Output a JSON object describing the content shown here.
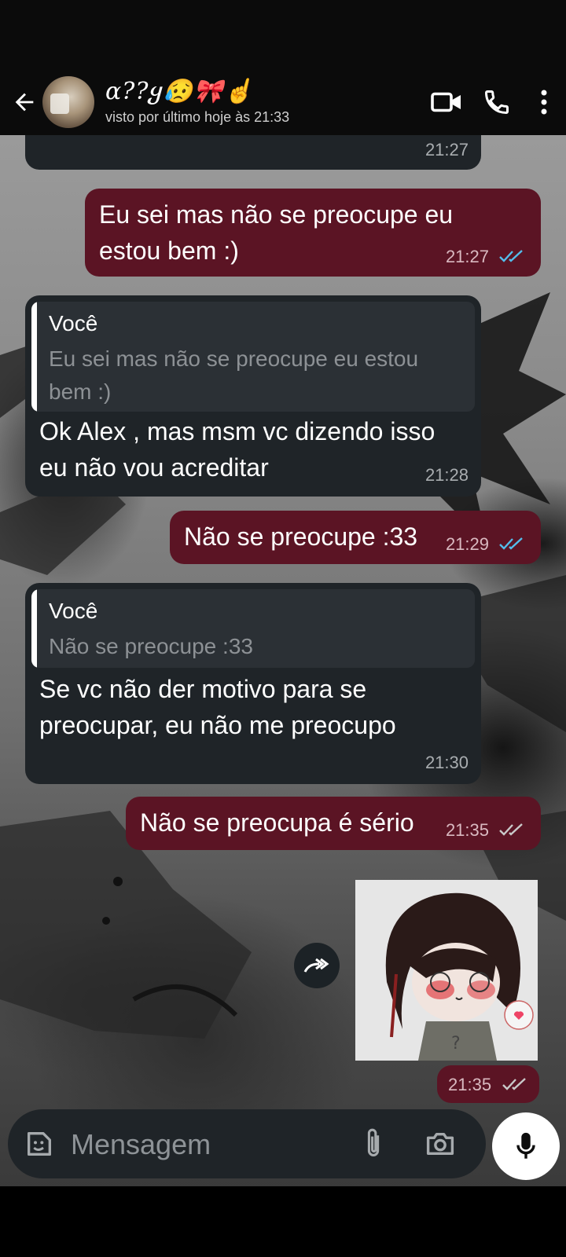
{
  "header": {
    "contact_name": "ɑ??ყ😥🎀☝",
    "last_seen": "visto por último hoje às 21:33"
  },
  "messages": [
    {
      "id": "m0",
      "direction": "in",
      "text": "",
      "time": "21:27"
    },
    {
      "id": "m1",
      "direction": "out",
      "lines": [
        "Eu sei mas não se preocupe eu",
        "estou bem :)"
      ],
      "time": "21:27",
      "status": "read"
    },
    {
      "id": "m2",
      "direction": "in",
      "quote_author": "Você",
      "quote_lines": [
        "Eu sei mas não se preocupe eu estou",
        "bem :)"
      ],
      "lines": [
        "Ok Alex , mas msm vc dizendo isso",
        "eu não vou acreditar"
      ],
      "time": "21:28"
    },
    {
      "id": "m3",
      "direction": "out",
      "lines": [
        "Não se preocupe :33"
      ],
      "time": "21:29",
      "status": "read"
    },
    {
      "id": "m4",
      "direction": "in",
      "quote_author": "Você",
      "quote_lines": [
        "Não se preocupe :33"
      ],
      "lines": [
        "Se vc não der motivo para se",
        "preocupar, eu não me preocupo"
      ],
      "time": "21:30"
    },
    {
      "id": "m5",
      "direction": "out",
      "lines": [
        "Não se preocupa é sério"
      ],
      "time": "21:35",
      "status": "delivered"
    },
    {
      "id": "m6",
      "direction": "out",
      "type": "sticker",
      "time": "21:35",
      "status": "delivered"
    }
  ],
  "input": {
    "placeholder": "Mensagem"
  },
  "colors": {
    "incoming": "#1f2428",
    "outgoing": "#5b1424",
    "read_tick": "#53bdeb",
    "delivered_tick": "#c9c9c9"
  },
  "icons": [
    "back-arrow-icon",
    "video-call-icon",
    "phone-icon",
    "more-vert-icon",
    "sticker-icon",
    "attach-icon",
    "camera-icon",
    "mic-icon",
    "forward-icon",
    "double-check-icon"
  ]
}
